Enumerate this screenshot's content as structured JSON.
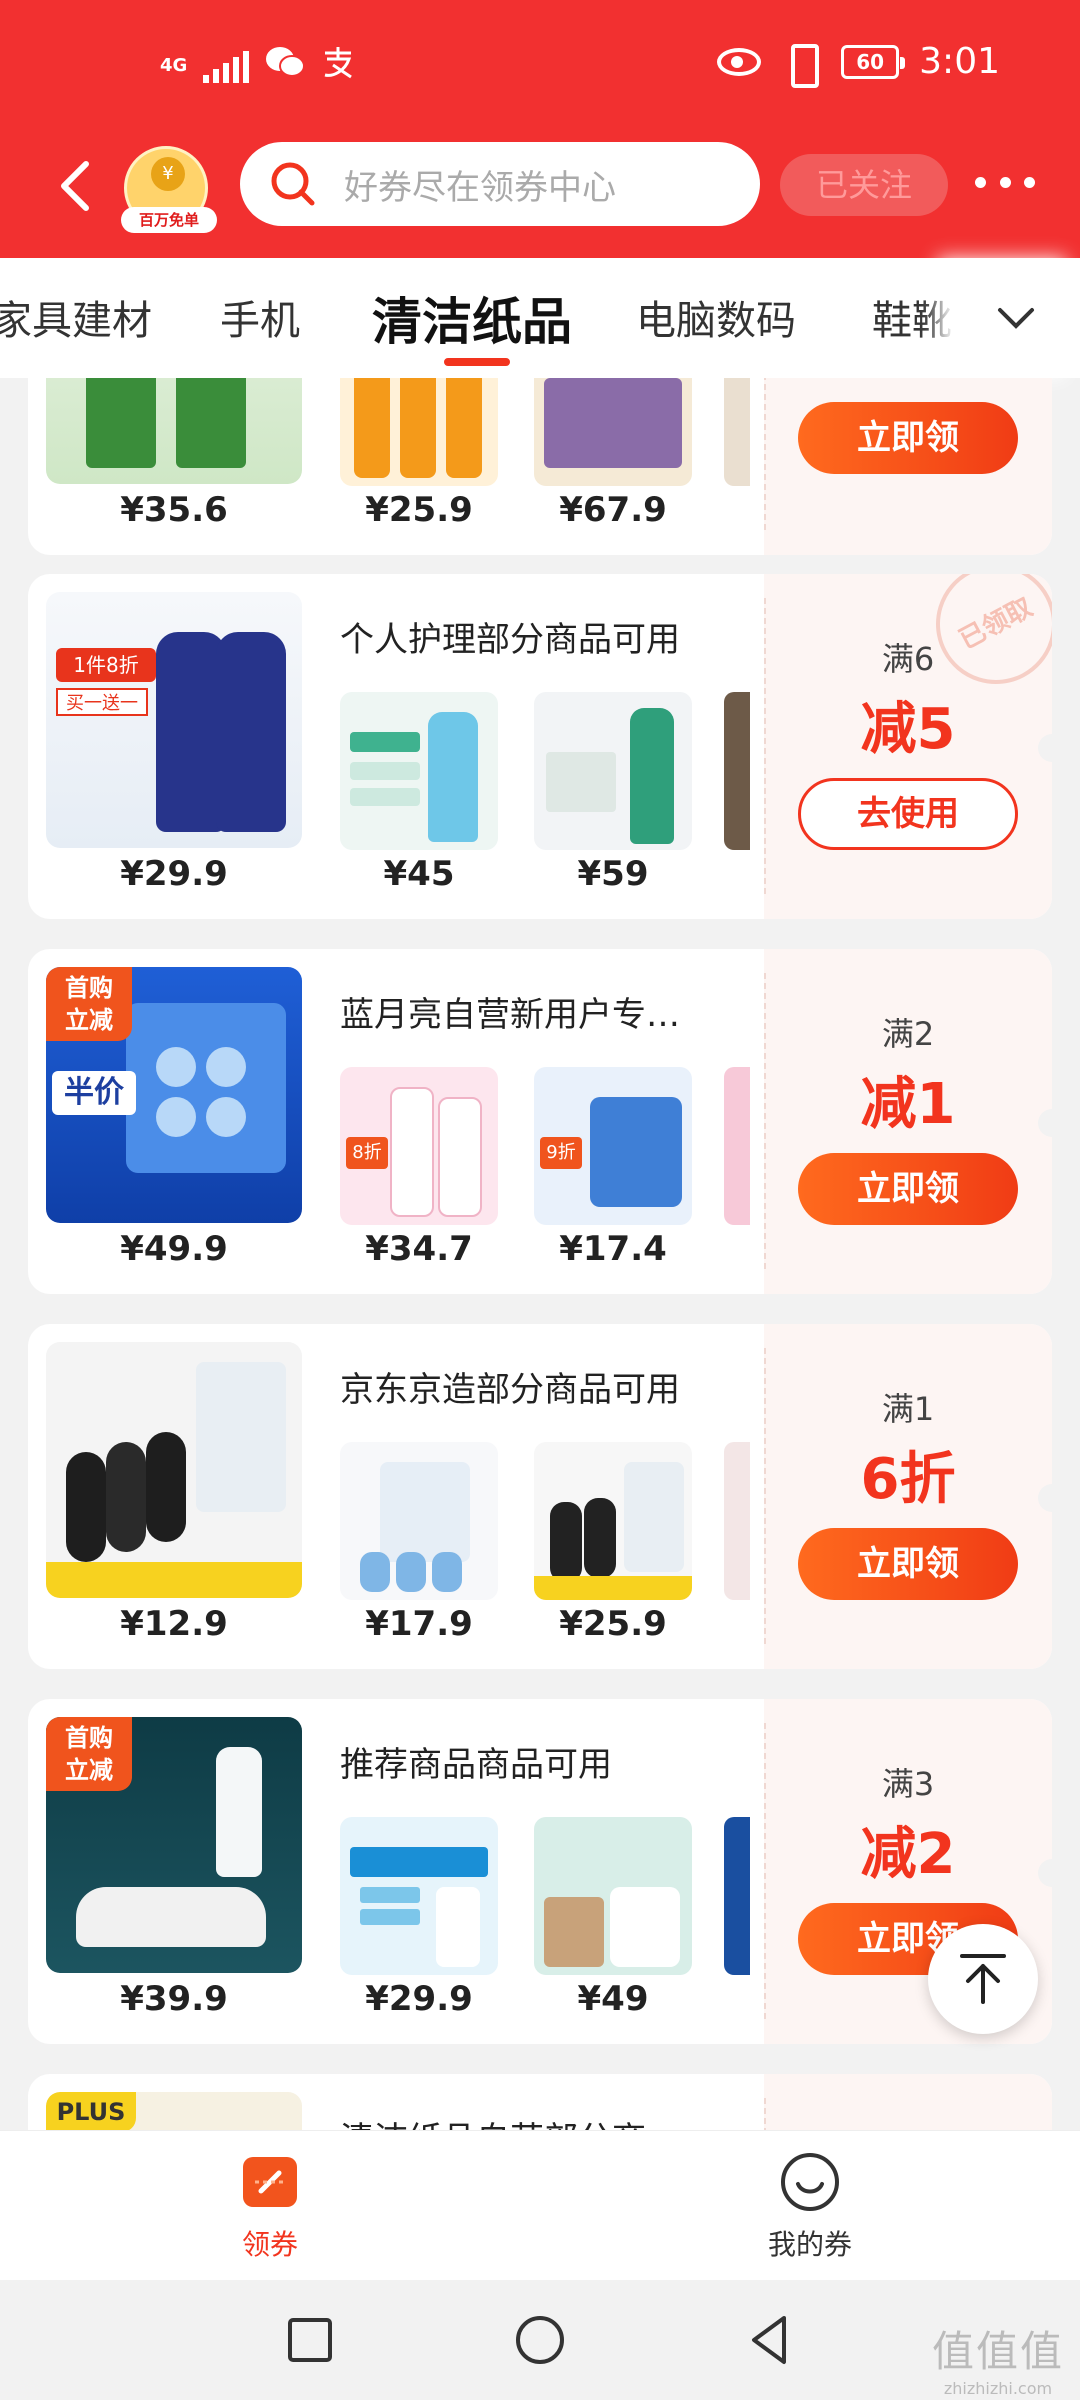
{
  "status_bar": {
    "network": "4G",
    "app_icons": [
      "wechat-icon",
      "alipay-icon"
    ],
    "battery": "60",
    "time": "3:01"
  },
  "header": {
    "badge_text": "百万免单",
    "search_placeholder": "好券尽在领券中心",
    "follow_label": "已关注"
  },
  "tabs": [
    {
      "label": "家具建材",
      "active": false
    },
    {
      "label": "手机",
      "active": false
    },
    {
      "label": "清洁纸品",
      "active": true
    },
    {
      "label": "电脑数码",
      "active": false
    },
    {
      "label": "鞋靴",
      "active": false
    }
  ],
  "coupons": [
    {
      "title": "",
      "main_price": "¥35.6",
      "sub_prices": [
        "¥25.9",
        "¥67.9"
      ],
      "condition": "",
      "amount": "",
      "button": "立即领",
      "claimed": false
    },
    {
      "title": "个人护理部分商品可用",
      "main_price": "¥29.9",
      "sub_prices": [
        "¥45",
        "¥59"
      ],
      "condition": "满6",
      "amount": "减5",
      "button": "去使用",
      "claimed": true,
      "stamp": "已领取",
      "main_tag": ""
    },
    {
      "title": "蓝月亮自营新用户专…",
      "main_price": "¥49.9",
      "sub_prices": [
        "¥34.7",
        "¥17.4"
      ],
      "condition": "满2",
      "amount": "减1",
      "button": "立即领",
      "claimed": false,
      "main_tag": "首购\n立减"
    },
    {
      "title": "京东京造部分商品可用",
      "main_price": "¥12.9",
      "sub_prices": [
        "¥17.9",
        "¥25.9"
      ],
      "condition": "满1",
      "amount": "6折",
      "button": "立即领",
      "claimed": false
    },
    {
      "title": "推荐商品商品可用",
      "main_price": "¥39.9",
      "sub_prices": [
        "¥29.9",
        "¥49"
      ],
      "condition": "满3",
      "amount": "减2",
      "button": "立即领",
      "claimed": false,
      "main_tag": "首购\n立减"
    },
    {
      "title": "清洁纸品自营部分商",
      "main_tag": "PLUS"
    }
  ],
  "bottom_nav": [
    {
      "label": "领券",
      "active": true,
      "icon": "coupon-icon"
    },
    {
      "label": "我的券",
      "active": false,
      "icon": "smile-icon"
    }
  ],
  "watermark": {
    "big": "值值值",
    "small": "zhizhizhi.com"
  },
  "colors": {
    "brand_red": "#f23030",
    "accent_orange": "#f2341e",
    "button_gradient_start": "#ff6a1e"
  }
}
